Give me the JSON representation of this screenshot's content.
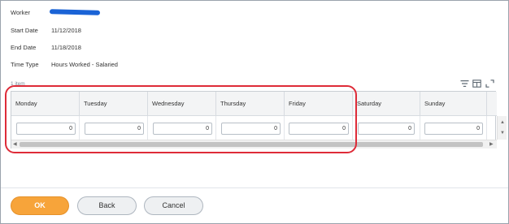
{
  "fields": {
    "worker_label": "Worker",
    "start_date_label": "Start Date",
    "start_date_value": "11/12/2018",
    "end_date_label": "End Date",
    "end_date_value": "11/18/2018",
    "time_type_label": "Time Type",
    "time_type_value": "Hours Worked - Salaried"
  },
  "grid": {
    "item_count": "1 item",
    "toolbar_icons": [
      "filter-icon",
      "column-chooser-icon",
      "expand-icon"
    ],
    "columns": [
      "Monday",
      "Tuesday",
      "Wednesday",
      "Thursday",
      "Friday",
      "Saturday",
      "Sunday"
    ],
    "values": [
      "0",
      "0",
      "0",
      "0",
      "0",
      "0",
      "0"
    ]
  },
  "colors": {
    "redaction": "#1a63d6",
    "highlight": "#de2b38",
    "primary_button": "#f7a43a"
  },
  "buttons": {
    "ok": "OK",
    "back": "Back",
    "cancel": "Cancel"
  }
}
